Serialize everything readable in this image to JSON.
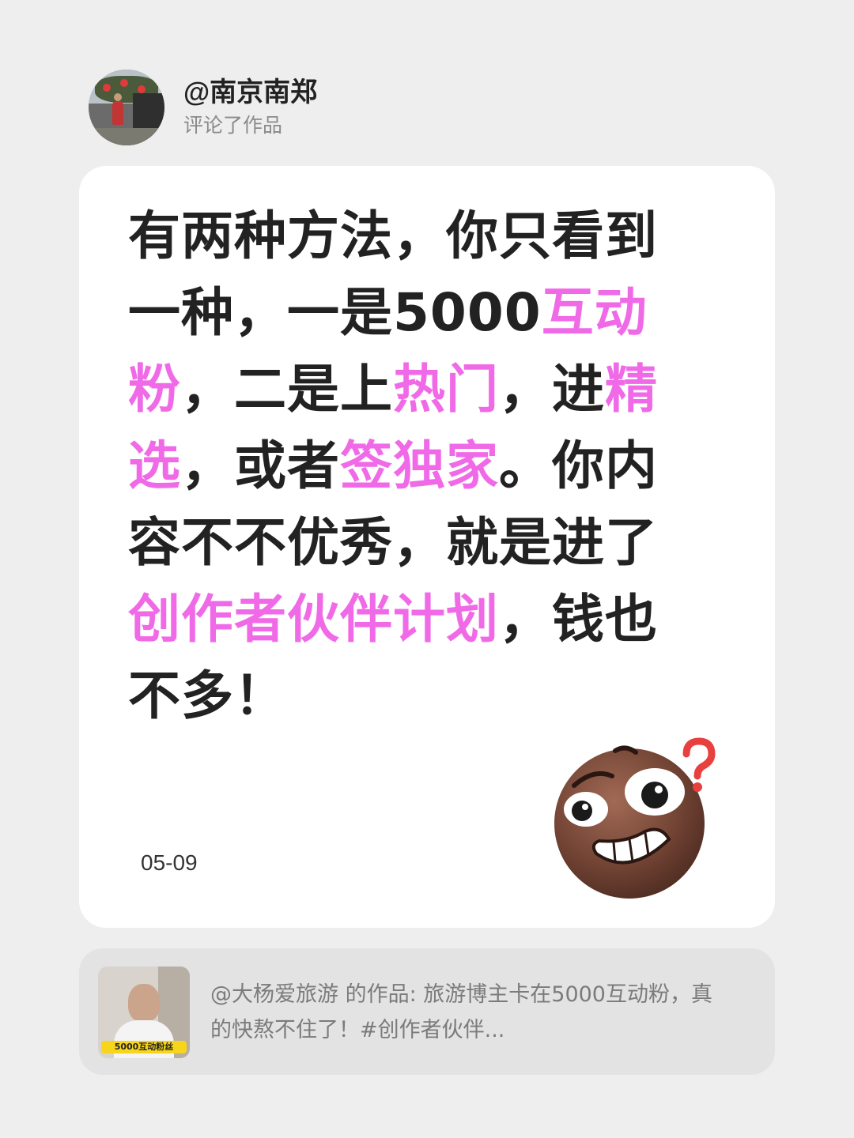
{
  "header": {
    "username": "@南京南郑",
    "action": "评论了作品"
  },
  "comment": {
    "segments": [
      {
        "text": "有两种方法，你只看到一种，一是5000",
        "highlight": false
      },
      {
        "text": "互动粉",
        "highlight": true
      },
      {
        "text": "，二是上",
        "highlight": false
      },
      {
        "text": "热门",
        "highlight": true
      },
      {
        "text": "，进",
        "highlight": false
      },
      {
        "text": "精选",
        "highlight": true
      },
      {
        "text": "，或者",
        "highlight": false
      },
      {
        "text": "签独家",
        "highlight": true
      },
      {
        "text": "。你内容不不优秀，就是进了",
        "highlight": false
      },
      {
        "text": "创作者伙伴计划",
        "highlight": true
      },
      {
        "text": "，钱也不多！",
        "highlight": false
      }
    ],
    "date": "05-09",
    "emoji_icon": "confused-grin-emoji-icon"
  },
  "reference": {
    "text": "@大杨爱旅游 的作品: 旅游博主卡在5000互动粉，真的快熬不住了！#创作者伙伴...",
    "thumbnail_label": "5000互动粉丝"
  },
  "colors": {
    "highlight": "#f06ae8",
    "text": "#222222",
    "muted": "#8a8a8a",
    "background": "#eeeeee",
    "card": "#ffffff",
    "reference_card": "#e3e3e3"
  }
}
